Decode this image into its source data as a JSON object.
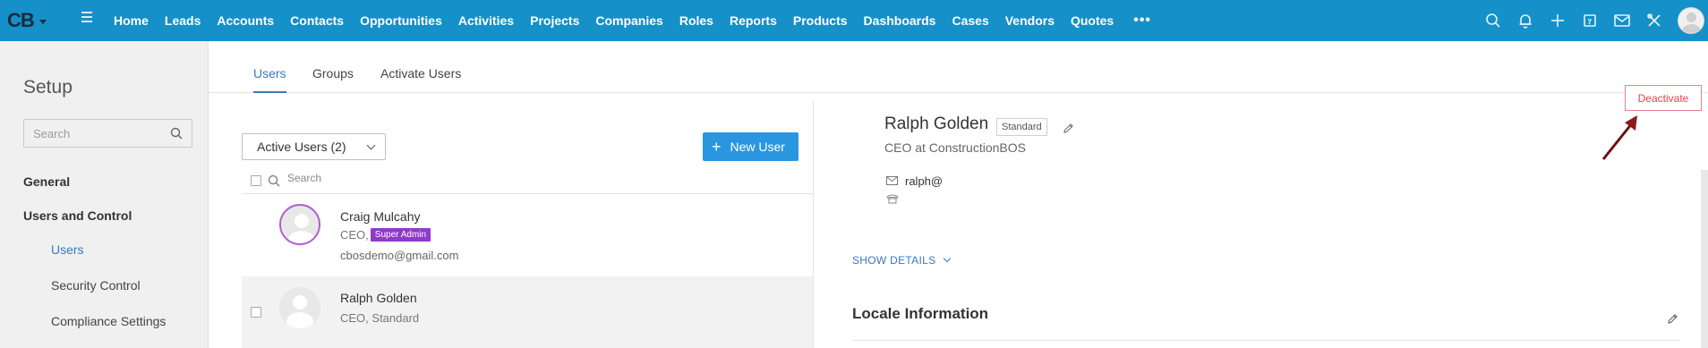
{
  "topbar": {
    "brand": "CB",
    "nav": [
      "Home",
      "Leads",
      "Accounts",
      "Contacts",
      "Opportunities",
      "Activities",
      "Projects",
      "Companies",
      "Roles",
      "Reports",
      "Products",
      "Dashboards",
      "Cases",
      "Vendors",
      "Quotes"
    ],
    "more": "•••",
    "icons": [
      "search-icon",
      "bell-icon",
      "plus-icon",
      "calendar-icon",
      "mail-icon",
      "tools-icon",
      "avatar"
    ],
    "bg_color": "#1590c9"
  },
  "sidebar": {
    "title": "Setup",
    "search_placeholder": "Search",
    "general": "General",
    "users_and_control": "Users and Control",
    "items": [
      {
        "label": "Users",
        "active": true
      },
      {
        "label": "Security Control",
        "active": false
      },
      {
        "label": "Compliance Settings",
        "active": false
      }
    ]
  },
  "tabs": [
    {
      "label": "Users",
      "active": true
    },
    {
      "label": "Groups",
      "active": false
    },
    {
      "label": "Activate Users",
      "active": false
    }
  ],
  "list": {
    "filter": "Active Users (2)",
    "new_user": "New User",
    "search_placeholder": "Search",
    "users": [
      {
        "name": "Craig Mulcahy",
        "role": "CEO,",
        "badge": "Super Admin",
        "email": "cbosdemo@gmail.com"
      },
      {
        "name": "Ralph Golden",
        "role": "CEO, Standard"
      }
    ]
  },
  "detail": {
    "name": "Ralph Golden",
    "profile": "Standard",
    "title": "CEO at ConstructionBOS",
    "email": "ralph@",
    "show_details": "SHOW DETAILS",
    "locale_heading": "Locale Information",
    "deactivate": "Deactivate"
  },
  "colors": {
    "accent": "#3a78c2",
    "primary_button": "#2a96e0",
    "danger": "#e04550",
    "admin_badge": "#8e3bc9",
    "annotation_arrow": "#8b1a1a"
  }
}
